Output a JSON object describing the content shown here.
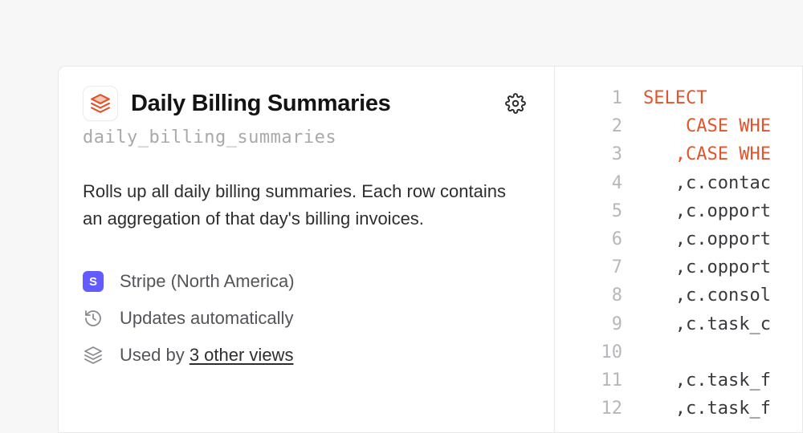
{
  "header": {
    "title": "Daily Billing Summaries",
    "slug": "daily_billing_summaries"
  },
  "description": "Rolls up all daily billing summaries. Each row contains an aggregation of that day's billing invoices.",
  "meta": {
    "source_badge_letter": "S",
    "source_label": "Stripe (North America)",
    "update_label": "Updates automatically",
    "usage_prefix": "Used by ",
    "usage_link": "3 other views"
  },
  "code": {
    "line_count": 12,
    "lines": [
      {
        "kw": "SELECT",
        "rest": ""
      },
      {
        "kw": "    CASE WHE",
        "rest": ""
      },
      {
        "kw": "   ,CASE WHE",
        "rest": ""
      },
      {
        "kw": "",
        "rest": "   ,c.contac"
      },
      {
        "kw": "",
        "rest": "   ,c.opport"
      },
      {
        "kw": "",
        "rest": "   ,c.opport"
      },
      {
        "kw": "",
        "rest": "   ,c.opport"
      },
      {
        "kw": "",
        "rest": "   ,c.consol"
      },
      {
        "kw": "",
        "rest": "   ,c.task_c"
      },
      {
        "kw": "",
        "rest": ""
      },
      {
        "kw": "",
        "rest": "   ,c.task_f"
      },
      {
        "kw": "",
        "rest": "   ,c.task_f"
      }
    ]
  }
}
